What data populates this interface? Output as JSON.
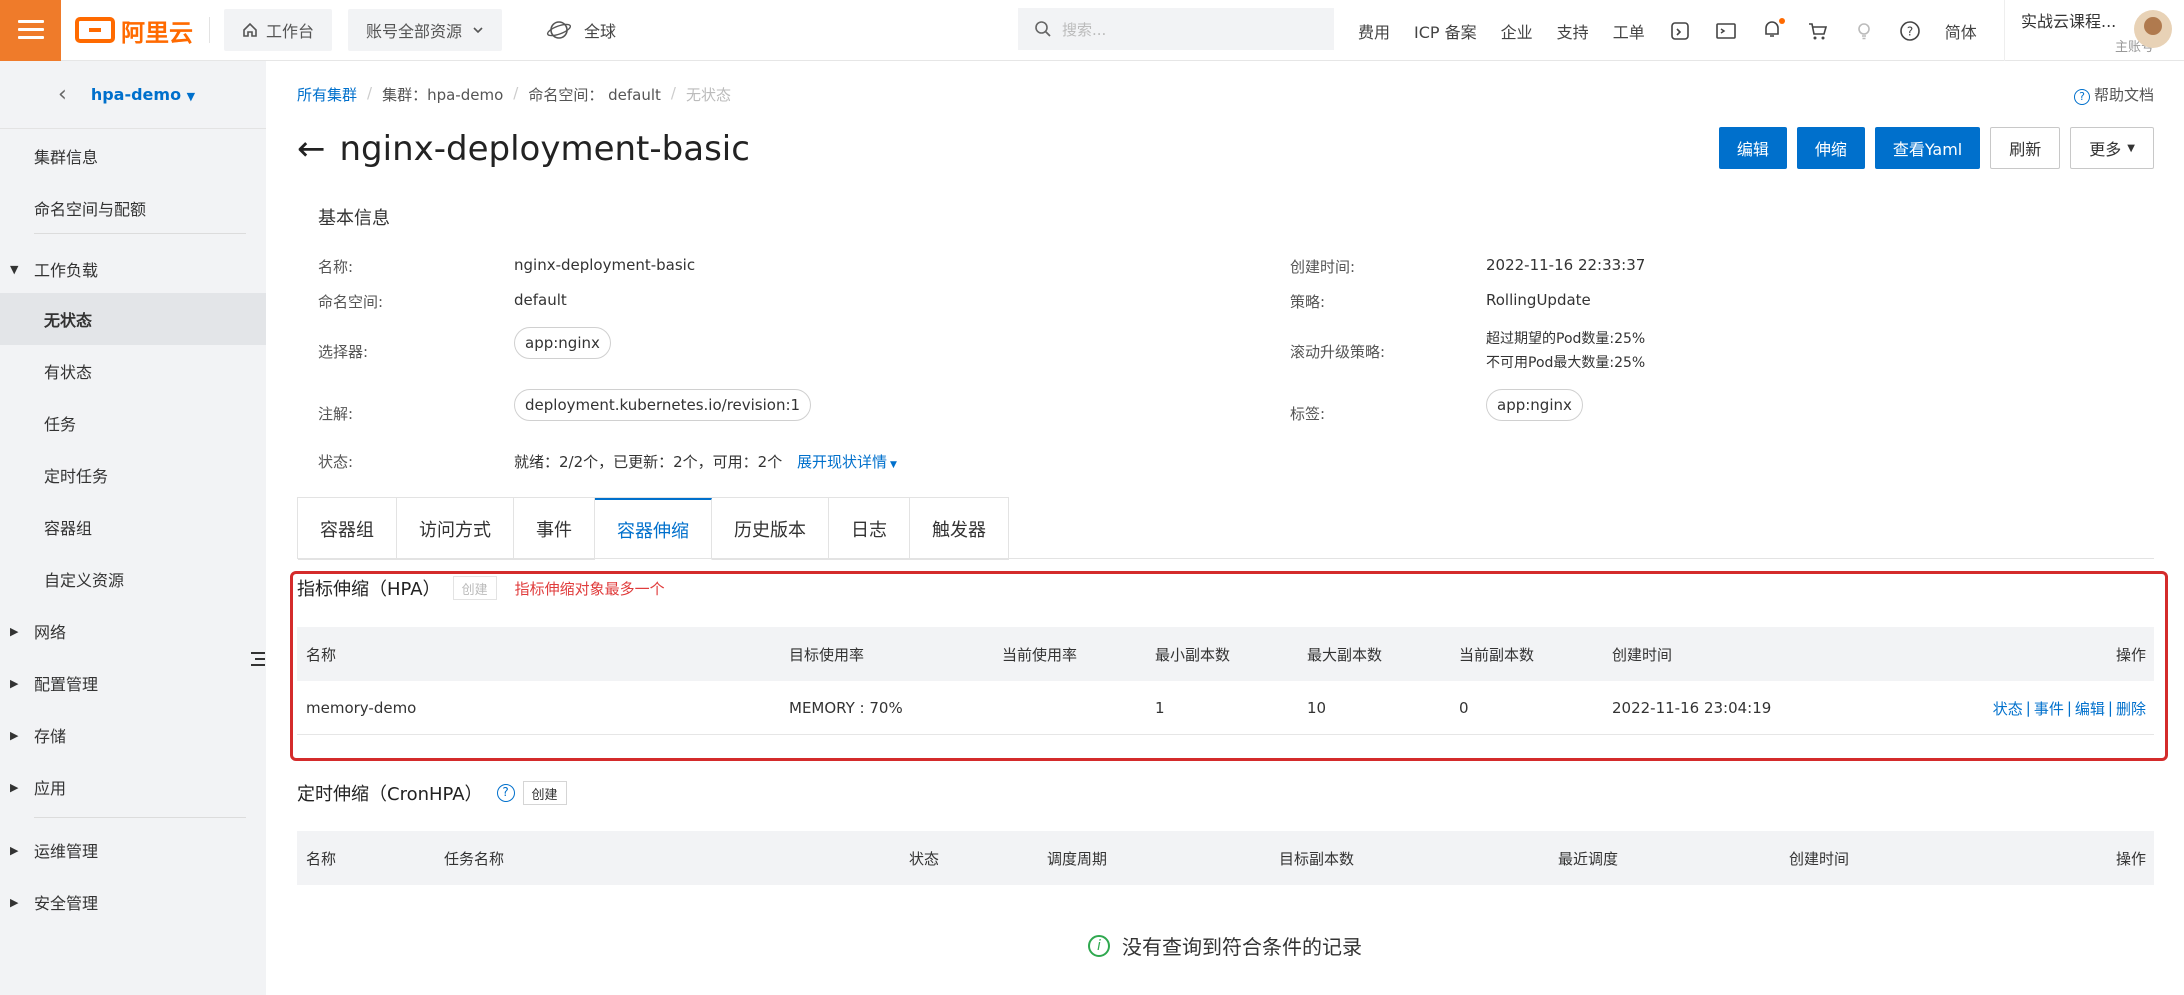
{
  "topbar": {
    "logo_text": "阿里云",
    "workbench": "工作台",
    "account_scope": "账号全部资源",
    "region": "全球",
    "search_placeholder": "搜索...",
    "links": [
      "费用",
      "ICP 备案",
      "企业",
      "支持",
      "工单"
    ],
    "lang": "简体",
    "user_name": "实战云课程...",
    "user_role": "主账号"
  },
  "sidebar": {
    "cluster": "hpa-demo",
    "items": [
      "集群信息",
      "命名空间与配额",
      "工作负载",
      "无状态",
      "有状态",
      "任务",
      "定时任务",
      "容器组",
      "自定义资源",
      "网络",
      "配置管理",
      "存储",
      "应用",
      "运维管理",
      "安全管理"
    ]
  },
  "breadcrumb": {
    "all_clusters": "所有集群",
    "cluster": "集群：hpa-demo",
    "namespace": "命名空间：  default",
    "current": "无状态"
  },
  "help_label": "帮助文档",
  "page_title": "nginx-deployment-basic",
  "actions": {
    "edit": "编辑",
    "scale": "伸缩",
    "yaml": "查看Yaml",
    "refresh": "刷新",
    "more": "更多"
  },
  "basic": {
    "section": "基本信息",
    "name_label": "名称:",
    "name": "nginx-deployment-basic",
    "ns_label": "命名空间:",
    "ns": "default",
    "selector_label": "选择器:",
    "selector": "app:nginx",
    "annotation_label": "注解:",
    "annotation": "deployment.kubernetes.io/revision:1",
    "status_label": "状态:",
    "status": "就绪：2/2个，已更新：2个，可用：2个",
    "status_link": "展开现状详情",
    "created_label": "创建时间:",
    "created": "2022-11-16 22:33:37",
    "strategy_label": "策略:",
    "strategy": "RollingUpdate",
    "rolling_label": "滚动升级策略:",
    "rolling_1": "超过期望的Pod数量:25%",
    "rolling_2": "不可用Pod最大数量:25%",
    "labels_label": "标签:",
    "labels": "app:nginx"
  },
  "tabs": [
    "容器组",
    "访问方式",
    "事件",
    "容器伸缩",
    "历史版本",
    "日志",
    "触发器"
  ],
  "hpa": {
    "title": "指标伸缩（HPA）",
    "create": "创建",
    "note": "指标伸缩对象最多一个",
    "headers": [
      "名称",
      "目标使用率",
      "当前使用率",
      "最小副本数",
      "最大副本数",
      "当前副本数",
      "创建时间",
      "操作"
    ],
    "row": {
      "name": "memory-demo",
      "target": "MEMORY : 70%",
      "current": "",
      "min": "1",
      "max": "10",
      "replicas": "0",
      "created": "2022-11-16 23:04:19",
      "ops": [
        "状态",
        "事件",
        "编辑",
        "删除"
      ]
    }
  },
  "cron": {
    "title": "定时伸缩（CronHPA）",
    "create": "创建",
    "headers": [
      "名称",
      "任务名称",
      "状态",
      "调度周期",
      "目标副本数",
      "最近调度",
      "创建时间",
      "操作"
    ],
    "empty": "没有查询到符合条件的记录"
  }
}
